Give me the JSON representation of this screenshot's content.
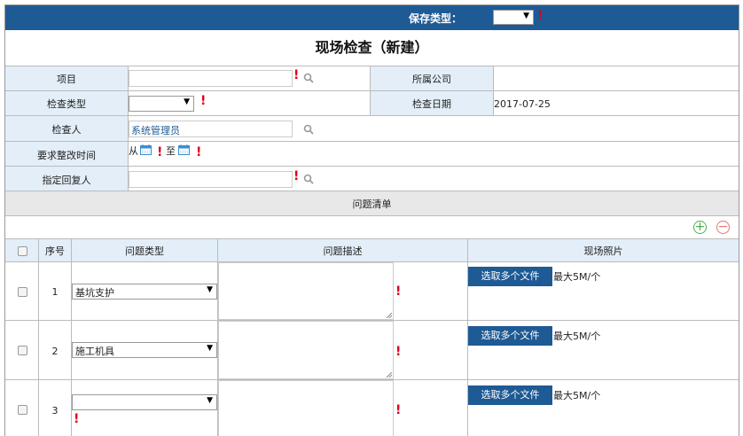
{
  "header": {
    "save_type_label": "保存类型："
  },
  "page_title": "现场检查（新建）",
  "form": {
    "project_label": "项目",
    "company_label": "所属公司",
    "company_value": "",
    "check_type_label": "检查类型",
    "check_date_label": "检查日期",
    "check_date_value": "2017-07-25",
    "inspector_label": "检查人",
    "inspector_value": "系统管理员",
    "rectify_time_label": "要求整改时间",
    "from_label": "从",
    "to_label": "至",
    "reply_person_label": "指定回复人"
  },
  "issue_list": {
    "section_title": "问题清单",
    "columns": [
      "序号",
      "问题类型",
      "问题描述",
      "现场照片"
    ],
    "rows": [
      {
        "no": "1",
        "type": "基坑支护",
        "button": "选取多个文件",
        "hint": "最大5M/个"
      },
      {
        "no": "2",
        "type": "施工机具",
        "button": "选取多个文件",
        "hint": "最大5M/个"
      },
      {
        "no": "3",
        "type": "",
        "button": "选取多个文件",
        "hint": "最大5M/个"
      }
    ]
  },
  "colors": {
    "header_bg": "#1e5a94",
    "label_bg": "#e3eef8",
    "required": "#e0001a",
    "add_btn": "#4caf50",
    "remove_btn": "#e57373"
  },
  "icons": [
    "search-icon",
    "calendar-icon",
    "plus-icon",
    "minus-icon",
    "chevron-down-icon",
    "required-icon"
  ]
}
